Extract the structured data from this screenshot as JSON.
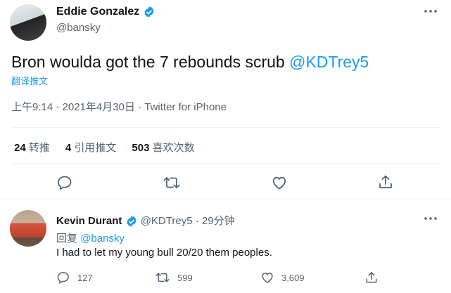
{
  "tweet": {
    "author": {
      "name": "Eddie Gonzalez",
      "handle": "@bansky"
    },
    "text_main": "Bron woulda got the 7 rebounds scrub ",
    "text_mention": "@KDTrey5",
    "translate": "翻译推文",
    "meta": "上午9:14 · 2021年4月30日 · Twitter for iPhone",
    "stats": [
      {
        "num": "24",
        "label": "转推"
      },
      {
        "num": "4",
        "label": "引用推文"
      },
      {
        "num": "503",
        "label": "喜欢次数"
      }
    ]
  },
  "reply": {
    "author": {
      "name": "Kevin Durant",
      "handle": "@KDTrey5"
    },
    "time": "· 29分钟",
    "reply_prefix": "回复 ",
    "reply_to": "@bansky",
    "text": "I had to let my young bull 20/20 them peoples.",
    "counts": {
      "replies": "127",
      "retweets": "599",
      "likes": "3,609"
    }
  },
  "icons": [
    "more-icon",
    "verified-icon",
    "reply-icon",
    "retweet-icon",
    "like-icon",
    "share-icon"
  ],
  "colors": {
    "accent": "#1d9bf0",
    "muted": "#536471",
    "text": "#0f1419",
    "divider": "#eff3f4"
  }
}
